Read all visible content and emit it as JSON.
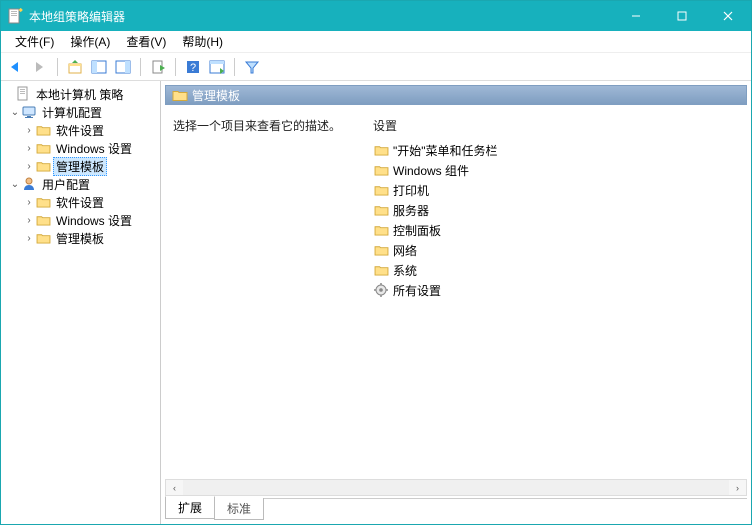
{
  "window": {
    "title": "本地组策略编辑器"
  },
  "menus": {
    "file": "文件(F)",
    "action": "操作(A)",
    "view": "查看(V)",
    "help": "帮助(H)"
  },
  "tree": {
    "root": "本地计算机 策略",
    "computer": "计算机配置",
    "user": "用户配置",
    "soft": "软件设置",
    "win": "Windows 设置",
    "admin": "管理模板"
  },
  "detail": {
    "heading": "管理模板",
    "desc": "选择一个项目来查看它的描述。",
    "col": "设置",
    "items": [
      "\"开始\"菜单和任务栏",
      "Windows 组件",
      "打印机",
      "服务器",
      "控制面板",
      "网络",
      "系统",
      "所有设置"
    ]
  },
  "tabs": {
    "extended": "扩展",
    "standard": "标准"
  }
}
